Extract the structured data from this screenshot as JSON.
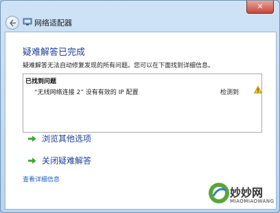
{
  "window": {
    "title": "网络适配器",
    "close_glyph": "✕"
  },
  "main": {
    "heading": "疑难解答已完成",
    "description": "疑难解答无法自动修复发现的所有问题。您可以在下面找到详细信息。"
  },
  "problems": {
    "header": "已找到问题",
    "items": [
      {
        "text": "“无线网络连接 2” 没有有效的 IP 配置",
        "status": "检测到",
        "icon": "warning-icon"
      }
    ]
  },
  "options": [
    {
      "label": "浏览其他选项",
      "icon": "green-arrow-icon"
    },
    {
      "label": "关闭疑难解答",
      "icon": "green-arrow-icon"
    }
  ],
  "footer": {
    "details_link": "查看详细信息"
  },
  "watermark": {
    "text": "妙妙网",
    "sub": "MIAOMIAOWANG"
  },
  "colors": {
    "heading": "#1e3f96",
    "link": "#1e5fbf",
    "arrow": "#3aa33a",
    "warning": "#f1c40f"
  }
}
